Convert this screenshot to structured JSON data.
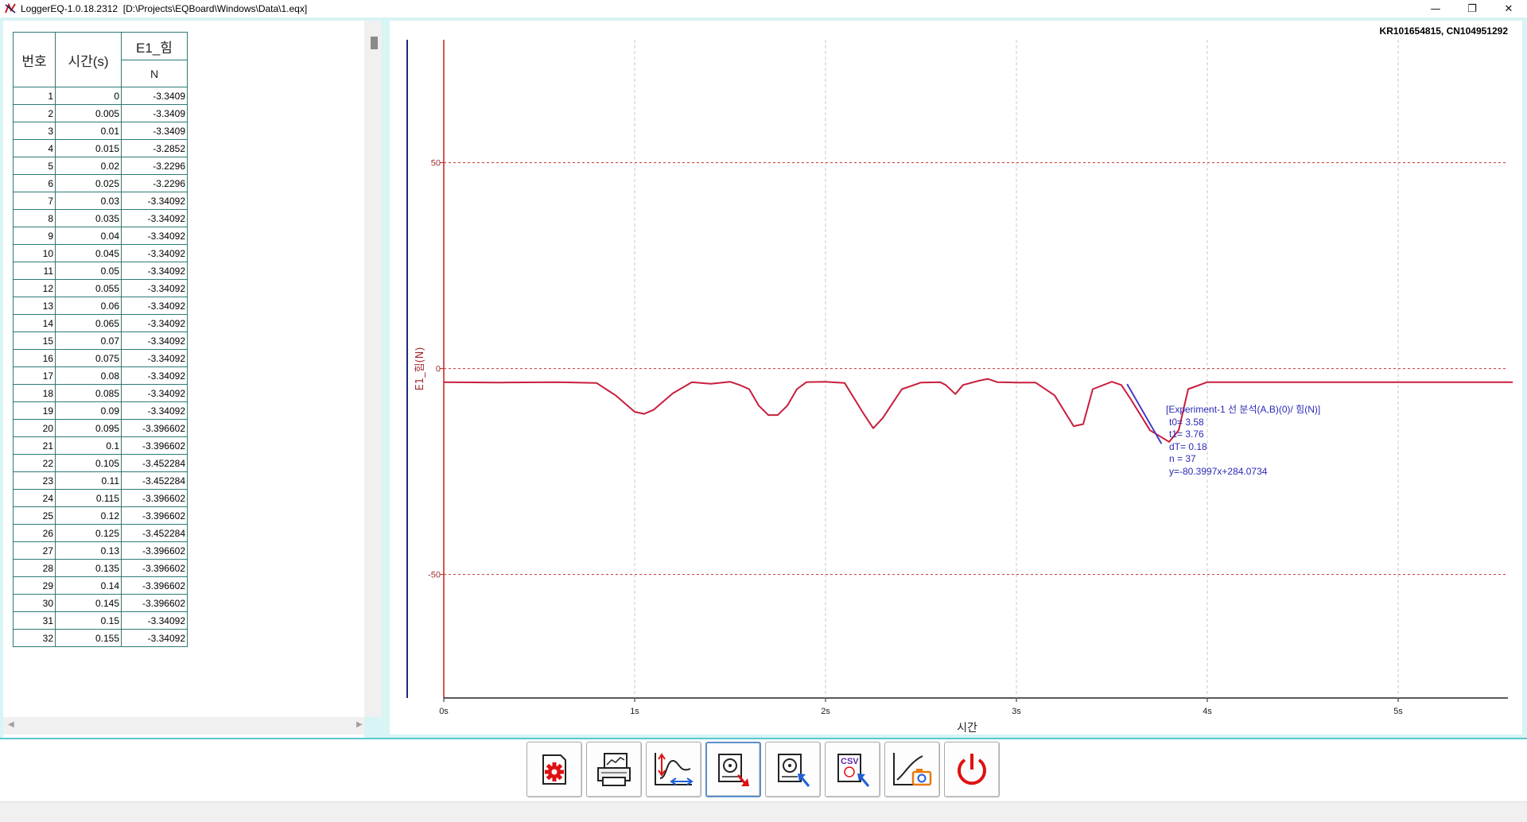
{
  "window": {
    "title": "LoggerEQ-1.0.18.2312  [D:\\Projects\\EQBoard\\Windows\\Data\\1.eqx]",
    "minimize_glyph": "—",
    "restore_glyph": "❐",
    "close_glyph": "✕"
  },
  "table": {
    "headers": {
      "no": "번호",
      "time": "시간(s)",
      "channel": "E1_힘",
      "unit": "N"
    },
    "rows": [
      [
        "1",
        "0",
        "-3.3409"
      ],
      [
        "2",
        "0.005",
        "-3.3409"
      ],
      [
        "3",
        "0.01",
        "-3.3409"
      ],
      [
        "4",
        "0.015",
        "-3.2852"
      ],
      [
        "5",
        "0.02",
        "-3.2296"
      ],
      [
        "6",
        "0.025",
        "-3.2296"
      ],
      [
        "7",
        "0.03",
        "-3.34092"
      ],
      [
        "8",
        "0.035",
        "-3.34092"
      ],
      [
        "9",
        "0.04",
        "-3.34092"
      ],
      [
        "10",
        "0.045",
        "-3.34092"
      ],
      [
        "11",
        "0.05",
        "-3.34092"
      ],
      [
        "12",
        "0.055",
        "-3.34092"
      ],
      [
        "13",
        "0.06",
        "-3.34092"
      ],
      [
        "14",
        "0.065",
        "-3.34092"
      ],
      [
        "15",
        "0.07",
        "-3.34092"
      ],
      [
        "16",
        "0.075",
        "-3.34092"
      ],
      [
        "17",
        "0.08",
        "-3.34092"
      ],
      [
        "18",
        "0.085",
        "-3.34092"
      ],
      [
        "19",
        "0.09",
        "-3.34092"
      ],
      [
        "20",
        "0.095",
        "-3.396602"
      ],
      [
        "21",
        "0.1",
        "-3.396602"
      ],
      [
        "22",
        "0.105",
        "-3.452284"
      ],
      [
        "23",
        "0.11",
        "-3.452284"
      ],
      [
        "24",
        "0.115",
        "-3.396602"
      ],
      [
        "25",
        "0.12",
        "-3.396602"
      ],
      [
        "26",
        "0.125",
        "-3.452284"
      ],
      [
        "27",
        "0.13",
        "-3.396602"
      ],
      [
        "28",
        "0.135",
        "-3.396602"
      ],
      [
        "29",
        "0.14",
        "-3.396602"
      ],
      [
        "30",
        "0.145",
        "-3.396602"
      ],
      [
        "31",
        "0.15",
        "-3.34092"
      ],
      [
        "32",
        "0.155",
        "-3.34092"
      ]
    ]
  },
  "chart": {
    "serial": "KR101654815, CN104951292",
    "xlabel": "시간",
    "ylabel": "E1_힘(N)",
    "xticks": [
      "0s",
      "1s",
      "2s",
      "3s",
      "4s",
      "5s"
    ],
    "yticks": [
      "50",
      "0",
      "-50"
    ],
    "annotation": [
      "[Experiment-1 선 분석(A,B)(0)/ 힘(N)]",
      "t0= 3.58",
      "t1= 3.76",
      "dT= 0.18",
      "n = 37",
      "y=-80.3997x+284.0734"
    ],
    "line_color": "#c81e3c",
    "fit_color": "#4a3cc8",
    "grid_color": "#c83232"
  },
  "chart_data": {
    "type": "line",
    "xlabel": "시간",
    "ylabel": "E1_힘(N)",
    "xlim": [
      0,
      5.6
    ],
    "ylim": [
      -80,
      80
    ],
    "series": [
      {
        "x": [
          0,
          0.3,
          0.6,
          0.8,
          0.9,
          1.0,
          1.05,
          1.1,
          1.2,
          1.3,
          1.4,
          1.5,
          1.55,
          1.6,
          1.65,
          1.7,
          1.75,
          1.8,
          1.85,
          1.9,
          2.0,
          2.1,
          2.2,
          2.25,
          2.3,
          2.4,
          2.5,
          2.6,
          2.63,
          2.68,
          2.72,
          2.8,
          2.85,
          2.9,
          3.0,
          3.1,
          3.2,
          3.3,
          3.35,
          3.4,
          3.5,
          3.55,
          3.6,
          3.7,
          3.8,
          3.85,
          3.9,
          4.0,
          4.5,
          5.0,
          5.4,
          5.6
        ],
        "y": [
          -3.3,
          -3.4,
          -3.3,
          -3.5,
          -6.5,
          -10.5,
          -11.0,
          -10.0,
          -6.0,
          -3.3,
          -3.7,
          -3.2,
          -4.0,
          -5.0,
          -9.0,
          -11.3,
          -11.3,
          -9.0,
          -5.0,
          -3.3,
          -3.2,
          -3.5,
          -11.0,
          -14.5,
          -12.0,
          -5.0,
          -3.4,
          -3.3,
          -4.0,
          -6.2,
          -4.0,
          -3.0,
          -2.5,
          -3.3,
          -3.4,
          -3.4,
          -6.5,
          -14.0,
          -13.5,
          -5.0,
          -3.2,
          -4.0,
          -7.5,
          -15.0,
          -17.8,
          -15.0,
          -5.0,
          -3.3,
          -3.3,
          -3.3,
          -3.3,
          -3.3
        ]
      },
      {
        "x": [
          3.58,
          3.76
        ],
        "y": [
          -3.76,
          -18.24
        ]
      }
    ]
  },
  "toolbar": [
    {
      "name": "settings-button",
      "icon": "gear-icon"
    },
    {
      "name": "print-button",
      "icon": "printer-icon"
    },
    {
      "name": "axis-scale-button",
      "icon": "axis-scale-icon"
    },
    {
      "name": "save-data-button",
      "icon": "disk-save-icon"
    },
    {
      "name": "open-data-button",
      "icon": "disk-open-icon"
    },
    {
      "name": "export-csv-button",
      "icon": "csv-export-icon"
    },
    {
      "name": "capture-graph-button",
      "icon": "camera-graph-icon"
    },
    {
      "name": "power-button",
      "icon": "power-icon"
    }
  ]
}
